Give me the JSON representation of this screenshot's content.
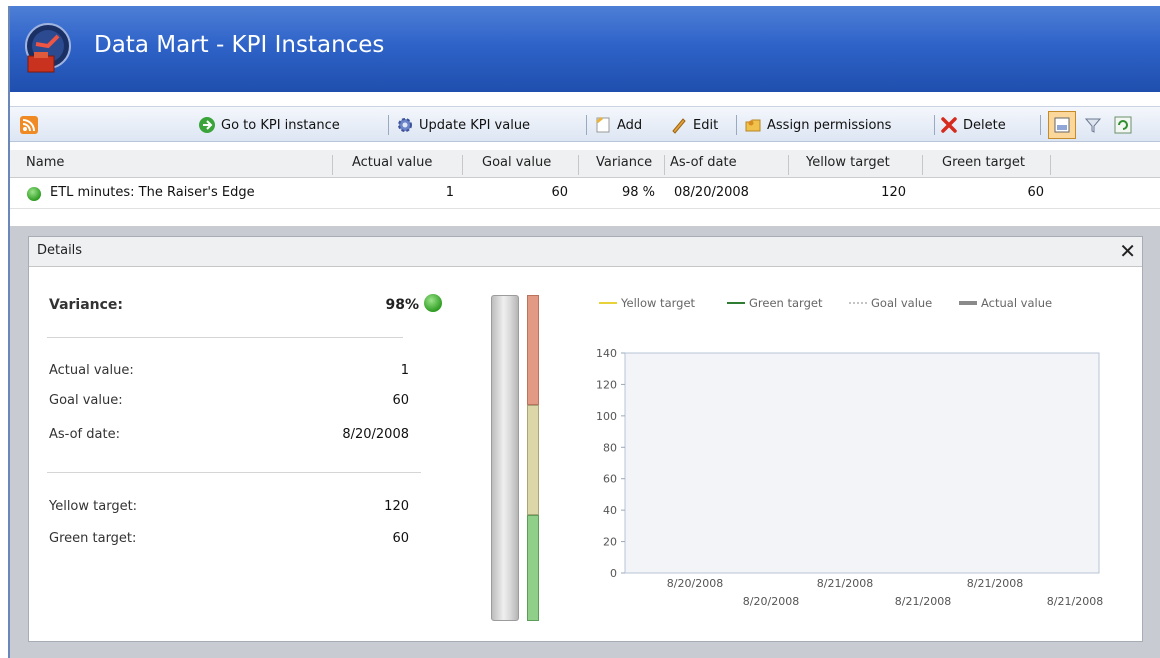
{
  "app": {
    "title": "Data Mart - KPI Instances"
  },
  "toolbar": {
    "go_to_kpi": "Go to KPI instance",
    "update_kpi": "Update KPI value",
    "add": "Add",
    "edit": "Edit",
    "assign_permissions": "Assign permissions",
    "delete": "Delete"
  },
  "grid": {
    "columns": {
      "name": "Name",
      "actual": "Actual value",
      "goal": "Goal value",
      "variance": "Variance",
      "asof": "As-of date",
      "yellow": "Yellow target",
      "green": "Green target"
    },
    "rows": [
      {
        "name": "ETL minutes: The Raiser's Edge",
        "actual": "1",
        "goal": "60",
        "variance": "98 %",
        "asof": "08/20/2008",
        "yellow": "120",
        "green": "60"
      }
    ]
  },
  "details": {
    "header": "Details",
    "variance_label": "Variance:",
    "variance_value": "98%",
    "actual_label": "Actual value:",
    "actual_value": "1",
    "goal_label": "Goal value:",
    "goal_value": "60",
    "asof_label": "As-of date:",
    "asof_value": "8/20/2008",
    "yellow_label": "Yellow target:",
    "yellow_value": "120",
    "green_label": "Green target:",
    "green_value": "60"
  },
  "colors": {
    "status_green": "#3fae2a",
    "yellow_line": "#e8d23a",
    "green_line": "#2e7d32",
    "goal_line": "#888888",
    "actual_line": "#8a8a8a",
    "gauge_red": "#e39a84",
    "gauge_yellow": "#dcd7a8",
    "gauge_green": "#8fcf8a"
  },
  "chart_data": {
    "type": "line",
    "series": [
      {
        "name": "Yellow target",
        "values": []
      },
      {
        "name": "Green target",
        "values": []
      },
      {
        "name": "Goal value",
        "values": []
      },
      {
        "name": "Actual value",
        "values": []
      }
    ],
    "yticks": [
      "0",
      "20",
      "40",
      "60",
      "80",
      "100",
      "120",
      "140"
    ],
    "ylim": [
      0,
      140
    ],
    "xticks_row1": [
      "8/20/2008",
      "8/21/2008",
      "8/21/2008"
    ],
    "xticks_row2": [
      "8/20/2008",
      "8/21/2008",
      "8/21/2008"
    ],
    "legend": "top"
  }
}
